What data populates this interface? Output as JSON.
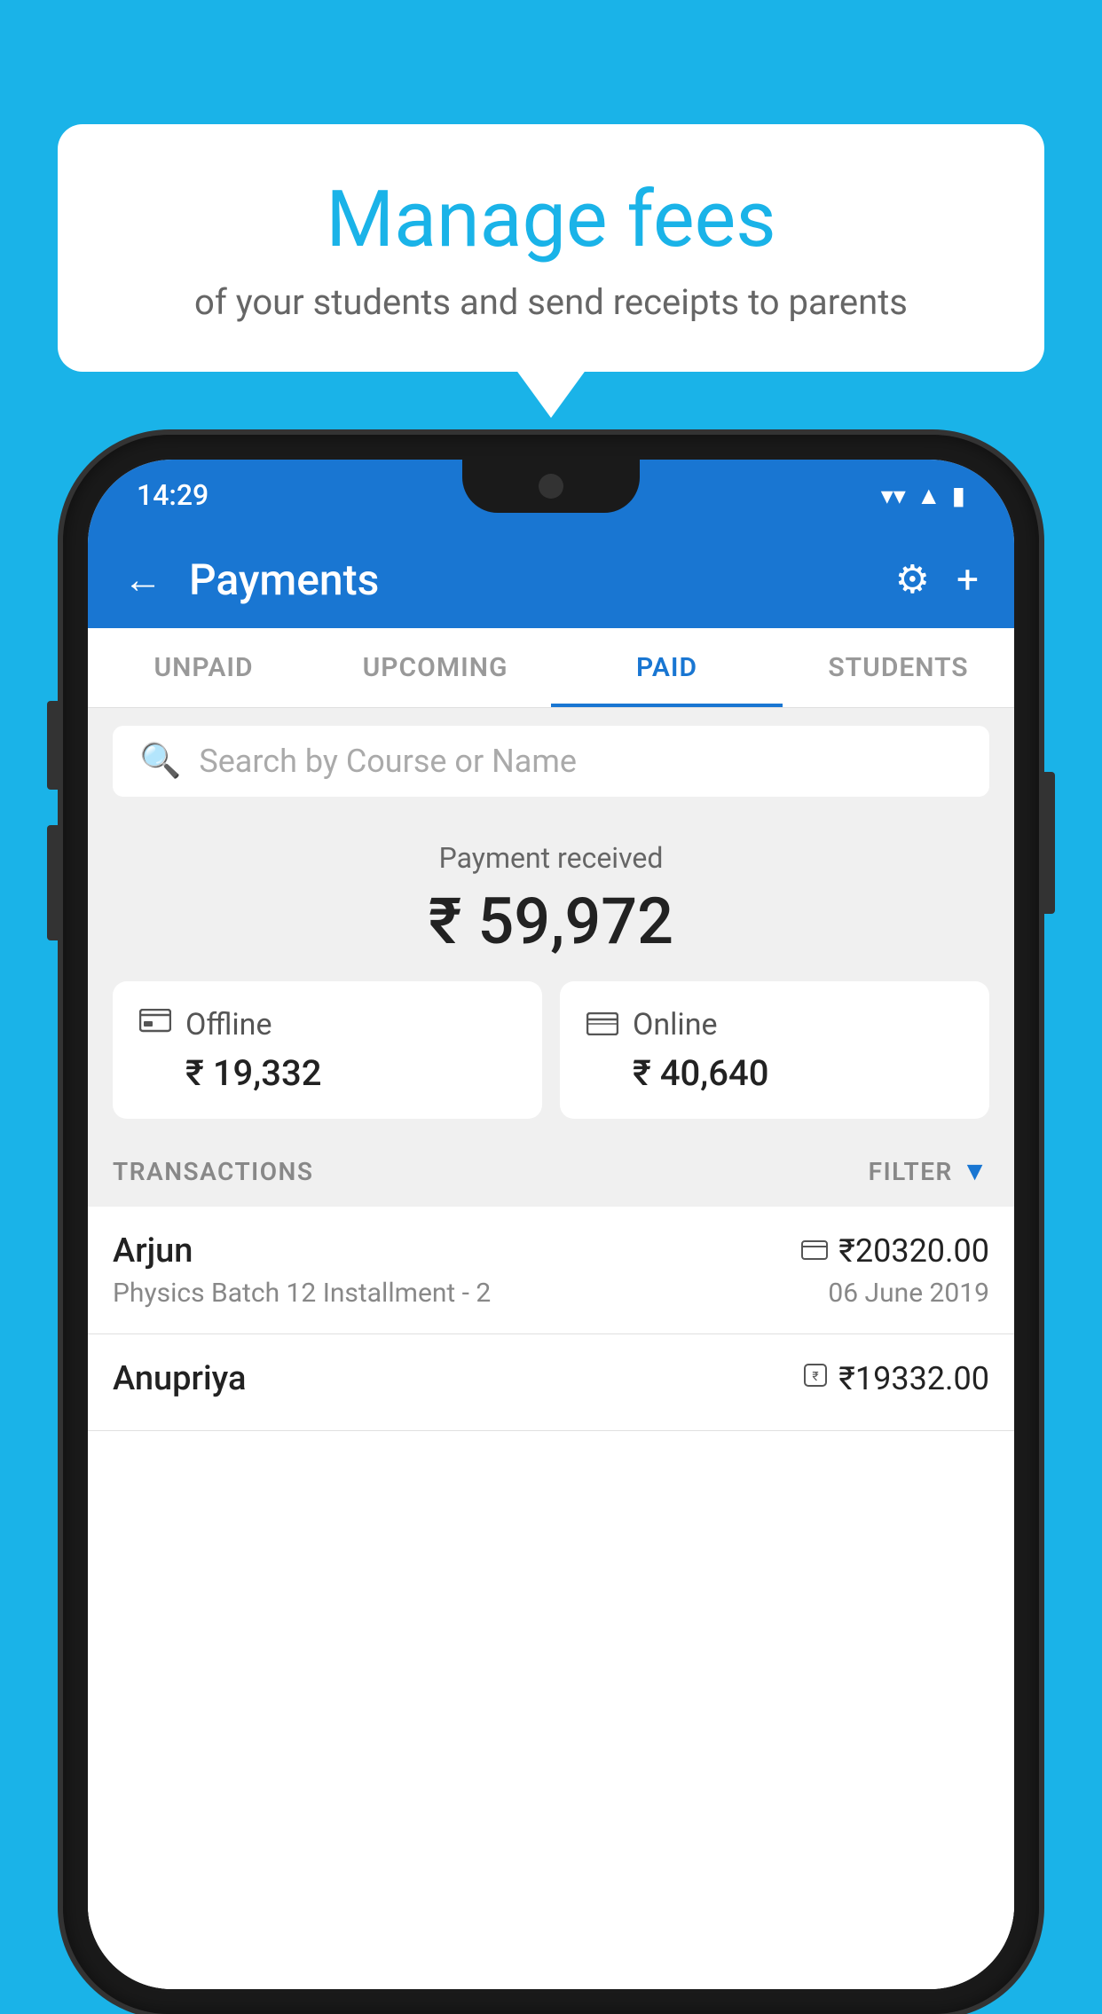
{
  "background_color": "#1ab3e8",
  "speech_bubble": {
    "title": "Manage fees",
    "subtitle": "of your students and send receipts to parents"
  },
  "status_bar": {
    "time": "14:29",
    "wifi_icon": "▼",
    "signal_icon": "▲",
    "battery_icon": "▮"
  },
  "app_bar": {
    "back_icon": "←",
    "title": "Payments",
    "gear_icon": "⚙",
    "plus_icon": "+"
  },
  "tabs": [
    {
      "label": "UNPAID",
      "active": false
    },
    {
      "label": "UPCOMING",
      "active": false
    },
    {
      "label": "PAID",
      "active": true
    },
    {
      "label": "STUDENTS",
      "active": false
    }
  ],
  "search": {
    "placeholder": "Search by Course or Name",
    "search_icon": "🔍"
  },
  "payment_summary": {
    "label": "Payment received",
    "amount": "₹ 59,972",
    "offline": {
      "type": "Offline",
      "amount": "₹ 19,332",
      "icon": "💳"
    },
    "online": {
      "type": "Online",
      "amount": "₹ 40,640",
      "icon": "💳"
    }
  },
  "transactions_section": {
    "label": "TRANSACTIONS",
    "filter_label": "FILTER",
    "filter_icon": "▼"
  },
  "transactions": [
    {
      "name": "Arjun",
      "amount": "₹20320.00",
      "amount_icon": "💳",
      "course": "Physics Batch 12 Installment - 2",
      "date": "06 June 2019"
    },
    {
      "name": "Anupriya",
      "amount": "₹19332.00",
      "amount_icon": "💷",
      "course": "",
      "date": ""
    }
  ]
}
